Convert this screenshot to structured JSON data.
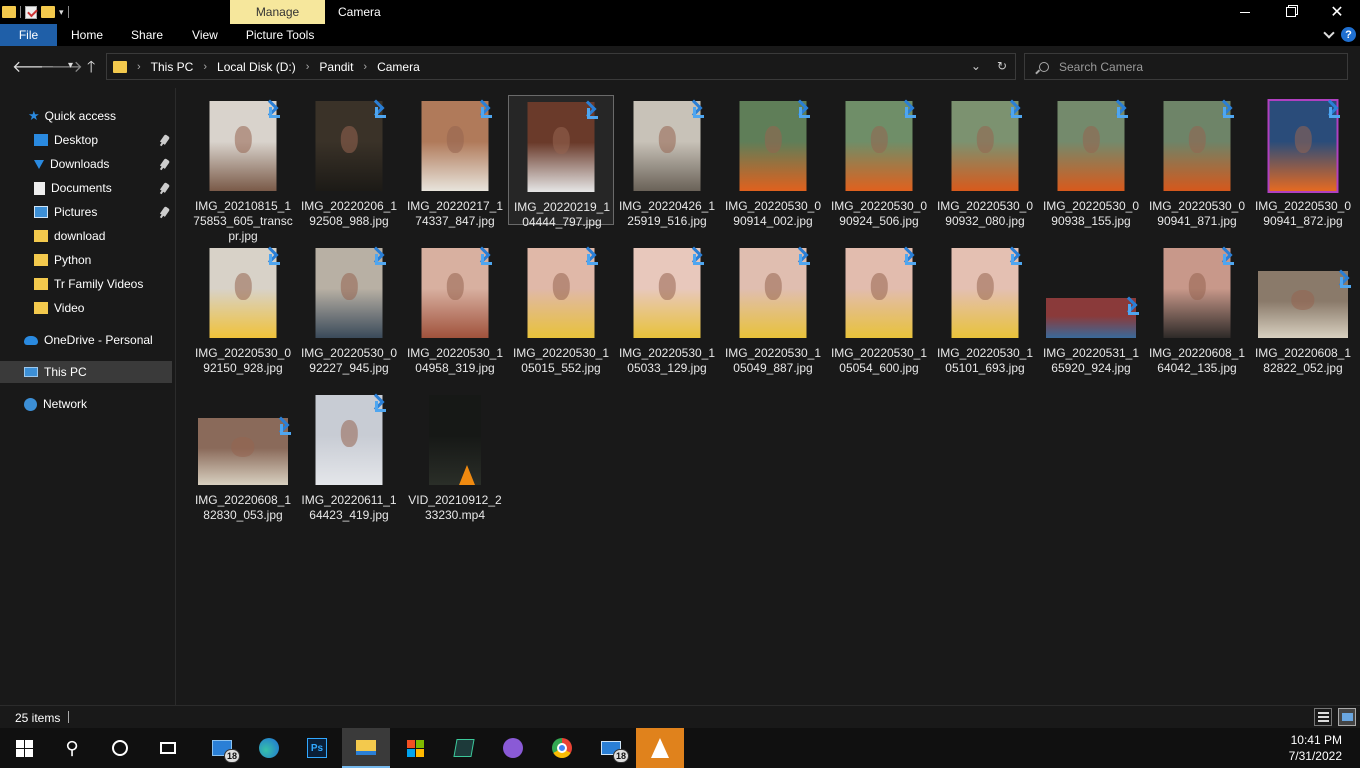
{
  "window": {
    "title": "Camera",
    "context_tab": "Manage"
  },
  "ribbon": {
    "tabs": [
      "File",
      "Home",
      "Share",
      "View",
      "Picture Tools"
    ]
  },
  "address": {
    "crumbs": [
      "This PC",
      "Local Disk (D:)",
      "Pandit",
      "Camera"
    ],
    "search_placeholder": "Search Camera"
  },
  "sidebar": {
    "quick_access": "Quick access",
    "items": [
      {
        "label": "Desktop",
        "icon": "desktop-icon",
        "pinned": true
      },
      {
        "label": "Downloads",
        "icon": "download-arrow-icon",
        "pinned": true
      },
      {
        "label": "Documents",
        "icon": "document-icon",
        "pinned": true
      },
      {
        "label": "Pictures",
        "icon": "pictures-icon",
        "pinned": true
      },
      {
        "label": "download",
        "icon": "folder-icon",
        "pinned": false
      },
      {
        "label": "Python",
        "icon": "folder-icon",
        "pinned": false
      },
      {
        "label": "Tr Family Videos",
        "icon": "folder-icon",
        "pinned": false
      },
      {
        "label": "Video",
        "icon": "folder-icon",
        "pinned": false
      }
    ],
    "onedrive": "OneDrive - Personal",
    "this_pc": "This PC",
    "network": "Network"
  },
  "files": [
    {
      "name": "IMG_20210815_175853_605_transcpr.jpg",
      "colors": [
        "#d9d3cc",
        "#7a5a48"
      ],
      "orient": "portrait"
    },
    {
      "name": "IMG_20220206_192508_988.jpg",
      "colors": [
        "#3a3228",
        "#1c1a16"
      ],
      "orient": "portrait"
    },
    {
      "name": "IMG_20220217_174337_847.jpg",
      "colors": [
        "#b07a5a",
        "#e8e4dc"
      ],
      "orient": "portrait"
    },
    {
      "name": "IMG_20220219_104444_797.jpg",
      "colors": [
        "#6a3a2a",
        "#e6e6e6"
      ],
      "orient": "portrait"
    },
    {
      "name": "IMG_20220426_125919_516.jpg",
      "colors": [
        "#c8c2b8",
        "#6a6258"
      ],
      "orient": "portrait"
    },
    {
      "name": "IMG_20220530_090914_002.jpg",
      "colors": [
        "#5f7e58",
        "#e0611e"
      ],
      "orient": "portrait"
    },
    {
      "name": "IMG_20220530_090924_506.jpg",
      "colors": [
        "#6f8e68",
        "#e0611e"
      ],
      "orient": "portrait"
    },
    {
      "name": "IMG_20220530_090932_080.jpg",
      "colors": [
        "#7c9270",
        "#d85a1c"
      ],
      "orient": "portrait"
    },
    {
      "name": "IMG_20220530_090938_155.jpg",
      "colors": [
        "#748a6c",
        "#d85a1c"
      ],
      "orient": "portrait"
    },
    {
      "name": "IMG_20220530_090941_871.jpg",
      "colors": [
        "#6e8468",
        "#d5581c"
      ],
      "orient": "portrait"
    },
    {
      "name": "IMG_20220530_090941_872.jpg",
      "colors": [
        "#2a4c7a",
        "#e56a22"
      ],
      "orient": "portrait"
    },
    {
      "name": "IMG_20220530_092150_928.jpg",
      "colors": [
        "#d8d2c8",
        "#f0c23a"
      ],
      "orient": "portrait"
    },
    {
      "name": "IMG_20220530_092227_945.jpg",
      "colors": [
        "#b8b0a4",
        "#3a4a5a"
      ],
      "orient": "portrait"
    },
    {
      "name": "IMG_20220530_104958_319.jpg",
      "colors": [
        "#d8b0a0",
        "#a0523c"
      ],
      "orient": "portrait"
    },
    {
      "name": "IMG_20220530_105015_552.jpg",
      "colors": [
        "#e0b8a8",
        "#e8c23a"
      ],
      "orient": "portrait"
    },
    {
      "name": "IMG_20220530_105033_129.jpg",
      "colors": [
        "#e8c8bc",
        "#e8c23a"
      ],
      "orient": "portrait"
    },
    {
      "name": "IMG_20220530_105049_887.jpg",
      "colors": [
        "#e0beb0",
        "#e8c23a"
      ],
      "orient": "portrait"
    },
    {
      "name": "IMG_20220530_105054_600.jpg",
      "colors": [
        "#e2bcae",
        "#e8c23a"
      ],
      "orient": "portrait"
    },
    {
      "name": "IMG_20220530_105101_693.jpg",
      "colors": [
        "#e4c0b2",
        "#e8c23a"
      ],
      "orient": "portrait"
    },
    {
      "name": "IMG_20220531_165920_924.jpg",
      "colors": [
        "#8a3a3a",
        "#3a6a9a"
      ],
      "orient": "landscape-thin"
    },
    {
      "name": "IMG_20220608_164042_135.jpg",
      "colors": [
        "#c8988a",
        "#2e2a28"
      ],
      "orient": "portrait"
    },
    {
      "name": "IMG_20220608_182822_052.jpg",
      "colors": [
        "#8a7a6a",
        "#d8d0c0"
      ],
      "orient": "landscape"
    },
    {
      "name": "IMG_20220608_182830_053.jpg",
      "colors": [
        "#8a6a5a",
        "#d8d0c0"
      ],
      "orient": "landscape"
    },
    {
      "name": "IMG_20220611_164423_419.jpg",
      "colors": [
        "#c8ccd4",
        "#e4e6ea"
      ],
      "orient": "portrait"
    },
    {
      "name": "VID_20210912_233230.mp4",
      "colors": [
        "#161816",
        "#2a2e28"
      ],
      "orient": "video"
    }
  ],
  "status": {
    "count": "25 items"
  },
  "taskbar": {
    "apps": [
      {
        "name": "start-button"
      },
      {
        "name": "search-button"
      },
      {
        "name": "cortana-button"
      },
      {
        "name": "task-view-button"
      },
      {
        "name": "app-taskbar-18",
        "badge": "18"
      },
      {
        "name": "edge-browser"
      },
      {
        "name": "photoshop"
      },
      {
        "name": "file-explorer"
      },
      {
        "name": "microsoft-store"
      },
      {
        "name": "app-green"
      },
      {
        "name": "github-desktop"
      },
      {
        "name": "chrome-browser"
      },
      {
        "name": "mail",
        "badge": "18"
      },
      {
        "name": "vlc-player"
      }
    ],
    "time": "10:41 PM",
    "date": "7/31/2022"
  },
  "colors": {
    "accent": "#1f5fa8",
    "manage_tab": "#f6e79c",
    "folder": "#f3c94d"
  }
}
